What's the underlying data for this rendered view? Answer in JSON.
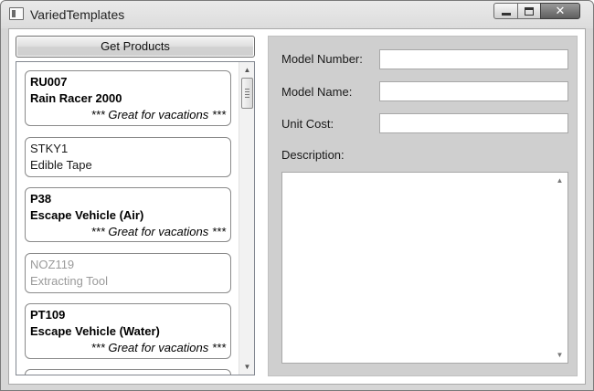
{
  "window": {
    "title": "VariedTemplates",
    "close_symbol": "✕"
  },
  "toolbar": {
    "get_products_label": "Get Products"
  },
  "products": [
    {
      "model_number": "RU007",
      "model_name": "Rain Racer 2000",
      "style": "featured",
      "tag": "*** Great for vacations ***"
    },
    {
      "model_number": "STKY1",
      "model_name": "Edible Tape",
      "style": "normal",
      "tag": ""
    },
    {
      "model_number": "P38",
      "model_name": "Escape Vehicle (Air)",
      "style": "featured",
      "tag": "*** Great for vacations ***"
    },
    {
      "model_number": "NOZ119",
      "model_name": "Extracting Tool",
      "style": "dim",
      "tag": ""
    },
    {
      "model_number": "PT109",
      "model_name": "Escape Vehicle (Water)",
      "style": "featured",
      "tag": "*** Great for vacations ***"
    }
  ],
  "details": {
    "model_number_label": "Model Number:",
    "model_number_value": "",
    "model_name_label": "Model Name:",
    "model_name_value": "",
    "unit_cost_label": "Unit Cost:",
    "unit_cost_value": "",
    "description_label": "Description:",
    "description_value": ""
  },
  "icons": {
    "app": "window-icon",
    "scroll_up": "▲",
    "scroll_down": "▼"
  }
}
